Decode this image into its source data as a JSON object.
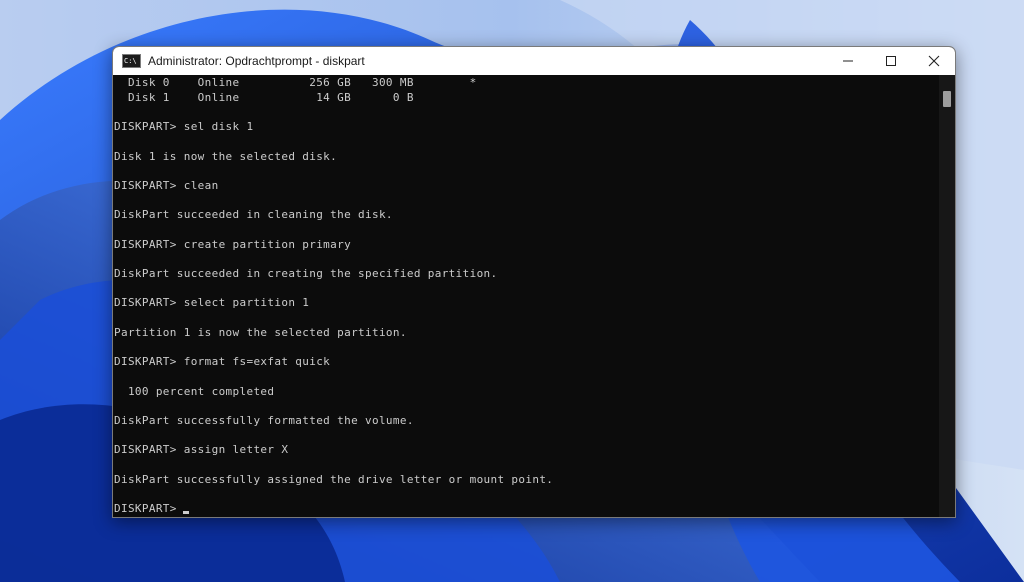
{
  "window": {
    "title": "Administrator: Opdrachtprompt - diskpart",
    "icon_text": "C:\\",
    "controls": {
      "minimize": "minimize-icon",
      "maximize": "maximize-icon",
      "close": "close-icon"
    }
  },
  "terminal": {
    "lines": [
      "  Disk 0    Online          256 GB   300 MB        *",
      "  Disk 1    Online           14 GB      0 B",
      "",
      "DISKPART> sel disk 1",
      "",
      "Disk 1 is now the selected disk.",
      "",
      "DISKPART> clean",
      "",
      "DiskPart succeeded in cleaning the disk.",
      "",
      "DISKPART> create partition primary",
      "",
      "DiskPart succeeded in creating the specified partition.",
      "",
      "DISKPART> select partition 1",
      "",
      "Partition 1 is now the selected partition.",
      "",
      "DISKPART> format fs=exfat quick",
      "",
      "  100 percent completed",
      "",
      "DiskPart successfully formatted the volume.",
      "",
      "DISKPART> assign letter X",
      "",
      "DiskPart successfully assigned the drive letter or mount point.",
      "",
      "DISKPART> "
    ]
  },
  "colors": {
    "terminal_bg": "#0c0c0c",
    "terminal_text": "#cccccc",
    "titlebar_bg": "#ffffff"
  }
}
